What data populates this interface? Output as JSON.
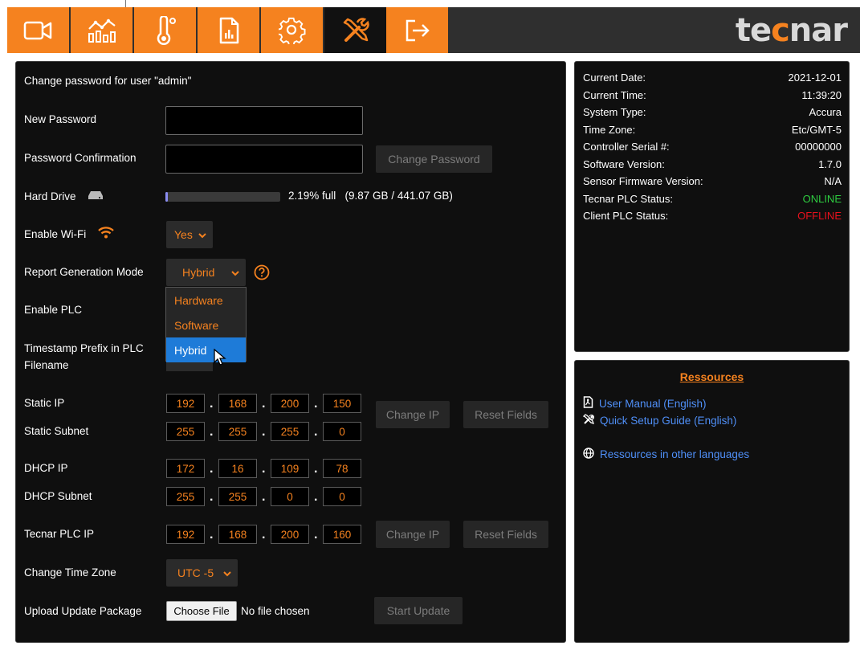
{
  "header": {
    "tabs": [
      {
        "name": "video",
        "icon": "video-camera-icon",
        "active": false
      },
      {
        "name": "statistics",
        "icon": "chart-icon",
        "active": false
      },
      {
        "name": "temperature",
        "icon": "thermometer-icon",
        "active": false
      },
      {
        "name": "reports",
        "icon": "report-icon",
        "active": false
      },
      {
        "name": "settings",
        "icon": "gear-icon",
        "active": false
      },
      {
        "name": "tools",
        "icon": "tools-icon",
        "active": true
      },
      {
        "name": "logout",
        "icon": "logout-icon",
        "active": false
      }
    ],
    "logo_text_pre": "te",
    "logo_text_accent": "c",
    "logo_text_post": "nar"
  },
  "colors": {
    "accent": "#f5821f",
    "online": "#2ecc40",
    "offline": "#e8101c",
    "link": "#4f8ff7",
    "selected": "#1e7bd8"
  },
  "form": {
    "title": "Change password for user \"admin\"",
    "new_password_label": "New Password",
    "confirm_label": "Password Confirmation",
    "change_password_button": "Change Password",
    "hard_drive_label": "Hard Drive",
    "hard_drive_fill_fraction": 0.0219,
    "hard_drive_text": "2.19% full   (9.87 GB / 441.07 GB)",
    "wifi_label": "Enable Wi-Fi",
    "wifi_value": "Yes",
    "report_mode_label": "Report Generation Mode",
    "report_mode_value": "Hybrid",
    "report_mode_options": [
      "Hardware",
      "Software",
      "Hybrid"
    ],
    "enable_plc_label": "Enable PLC",
    "timestamp_label_1": "Timestamp Prefix in PLC",
    "timestamp_label_2": "Filename",
    "static_ip_label": "Static IP",
    "static_ip": [
      "192",
      "168",
      "200",
      "150"
    ],
    "static_subnet_label": "Static Subnet",
    "static_subnet": [
      "255",
      "255",
      "255",
      "0"
    ],
    "change_ip_button": "Change IP",
    "reset_fields_button": "Reset Fields",
    "dhcp_ip_label": "DHCP IP",
    "dhcp_ip": [
      "172",
      "16",
      "109",
      "78"
    ],
    "dhcp_subnet_label": "DHCP Subnet",
    "dhcp_subnet": [
      "255",
      "255",
      "0",
      "0"
    ],
    "tecnar_plc_ip_label": "Tecnar PLC IP",
    "tecnar_plc_ip": [
      "192",
      "168",
      "200",
      "160"
    ],
    "change_ip_button_2": "Change IP",
    "reset_fields_button_2": "Reset Fields",
    "time_zone_label": "Change Time Zone",
    "time_zone_value": "UTC -5",
    "upload_label": "Upload Update Package",
    "choose_file_button": "Choose File",
    "no_file_text": "No file chosen",
    "start_update_button": "Start Update"
  },
  "info": {
    "rows": [
      {
        "label": "Current Date:",
        "value": "2021-12-01"
      },
      {
        "label": "Current Time:",
        "value": "11:39:20"
      },
      {
        "label": "System Type:",
        "value": "Accura"
      },
      {
        "label": "Time Zone:",
        "value": "Etc/GMT-5"
      },
      {
        "label": "Controller Serial #:",
        "value": "00000000"
      },
      {
        "label": "Software Version:",
        "value": "1.7.0"
      },
      {
        "label": "Sensor Firmware Version:",
        "value": "N/A"
      },
      {
        "label": "Tecnar PLC Status:",
        "value": "ONLINE"
      },
      {
        "label": "Client PLC Status:",
        "value": "OFFLINE"
      }
    ]
  },
  "resources": {
    "title": "Ressources",
    "links": [
      {
        "label": "User Manual (English)",
        "icon": "pdf-icon"
      },
      {
        "label": "Quick Setup Guide (English)",
        "icon": "tools-icon"
      },
      {
        "label": "Ressources in other languages",
        "icon": "globe-icon"
      }
    ]
  }
}
